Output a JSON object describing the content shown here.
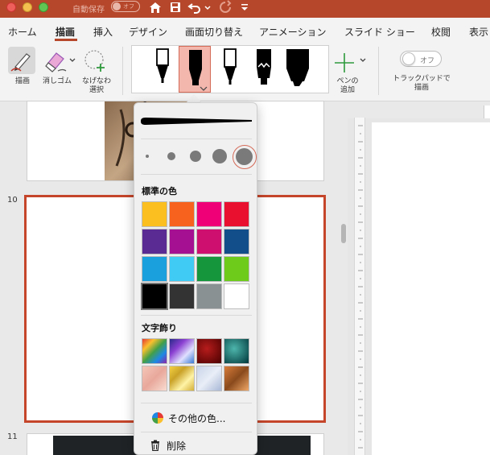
{
  "titlebar": {
    "autosave_label": "自動保存",
    "autosave_toggle": "オフ",
    "colors": {
      "close": "#ee5f5b",
      "min": "#f5bf4f",
      "max": "#61c554",
      "bar": "#b7472a"
    }
  },
  "tabs": [
    {
      "label": "ホーム"
    },
    {
      "label": "描画"
    },
    {
      "label": "挿入"
    },
    {
      "label": "デザイン"
    },
    {
      "label": "画面切り替え"
    },
    {
      "label": "アニメーション"
    },
    {
      "label": "スライド ショー"
    },
    {
      "label": "校閲"
    },
    {
      "label": "表示"
    }
  ],
  "ribbon": {
    "draw_label": "描画",
    "eraser_label": "消しゴム",
    "lasso_label_1": "なげなわ",
    "lasso_label_2": "選択",
    "add_pen_label_1": "ペンの",
    "add_pen_label_2": "追加",
    "trackpad_toggle": "オフ",
    "trackpad_label_1": "トラックパッドで",
    "trackpad_label_2": "描画"
  },
  "slides": {
    "slide10_number": "10",
    "slide11_number": "11"
  },
  "popup": {
    "standard_colors_title": "標準の色",
    "texture_title": "文字飾り",
    "more_colors_label": "その他の色...",
    "delete_label": "削除",
    "standard_colors": [
      "#fbbf1f",
      "#f7621f",
      "#ef0077",
      "#e8102e",
      "#5b2b94",
      "#a51093",
      "#ce0f6f",
      "#124e8a",
      "#1aa0dc",
      "#3fcbf4",
      "#15963c",
      "#6ecb1b",
      "#000000",
      "#333333",
      "#8a9193",
      "#ffffff"
    ]
  }
}
